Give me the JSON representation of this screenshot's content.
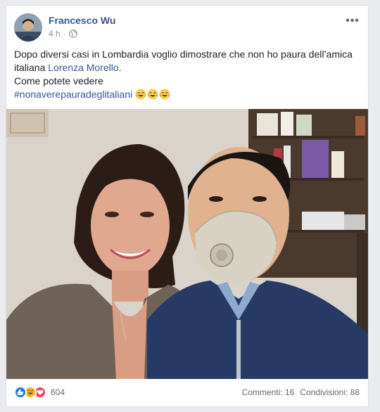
{
  "post": {
    "author": "Francesco Wu",
    "time": "4 h",
    "more_label": "•••",
    "text_line1": "Dopo diversi casi in Lombardia voglio dimostrare che non ho paura dell’amica italiana ",
    "mention": "Lorenza Morello",
    "text_after_mention": ".",
    "text_line2": "Come potete vedere",
    "hashtag": "#nonaverepauradeglitaliani"
  },
  "footer": {
    "reactions_count": "604",
    "comments": "Commenti: 16",
    "shares": "Condivisioni: 88"
  },
  "icons": {
    "globe": "globe-icon",
    "like": "like-reaction-icon",
    "haha": "haha-reaction-icon",
    "love": "love-reaction-icon",
    "laugh_emoji": "laughing-tears-emoji"
  },
  "colors": {
    "link": "#385898",
    "like": "#1877f2",
    "love": "#f33e58",
    "haha": "#f7b125"
  }
}
